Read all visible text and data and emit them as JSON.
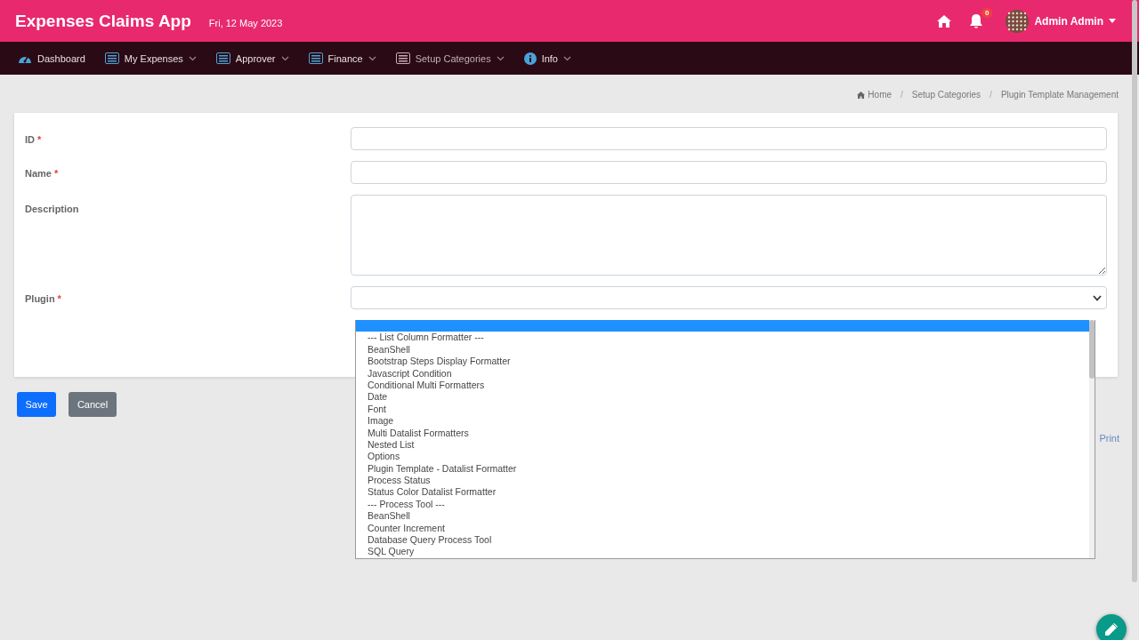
{
  "header": {
    "title": "Expenses Claims App",
    "date": "Fri, 12 May 2023",
    "notification_count": "0",
    "user": "Admin Admin"
  },
  "nav": [
    {
      "label": "Dashboard",
      "dropdown": false
    },
    {
      "label": "My Expenses",
      "dropdown": true
    },
    {
      "label": "Approver",
      "dropdown": true
    },
    {
      "label": "Finance",
      "dropdown": true
    },
    {
      "label": "Setup Categories",
      "dropdown": true
    },
    {
      "label": "Info",
      "dropdown": true
    }
  ],
  "breadcrumb": [
    {
      "label": "Home"
    },
    {
      "separator": "/",
      "label": "Setup Categories"
    },
    {
      "separator": "/",
      "label": "Plugin Template Management"
    }
  ],
  "form": {
    "fields": [
      {
        "label": "ID",
        "required_mark": "*",
        "kind": "text"
      },
      {
        "label": "Name",
        "required_mark": "*",
        "kind": "text"
      },
      {
        "label": "Description",
        "kind": "textarea"
      },
      {
        "label": "Plugin",
        "required_mark": "*",
        "kind": "select"
      }
    ]
  },
  "plugin_dropdown": {
    "options": [
      {
        "selected": true
      },
      {
        "label": "--- List Column Formatter ---",
        "selected": false
      },
      {
        "label": "BeanShell",
        "selected": false
      },
      {
        "label": "Bootstrap Steps Display Formatter",
        "selected": false
      },
      {
        "label": "Javascript Condition",
        "selected": false
      },
      {
        "label": "Conditional Multi Formatters",
        "selected": false
      },
      {
        "label": "Date",
        "selected": false
      },
      {
        "label": "Font",
        "selected": false
      },
      {
        "label": "Image",
        "selected": false
      },
      {
        "label": "Multi Datalist Formatters",
        "selected": false
      },
      {
        "label": "Nested List",
        "selected": false
      },
      {
        "label": "Options",
        "selected": false
      },
      {
        "label": "Plugin Template - Datalist Formatter",
        "selected": false
      },
      {
        "label": "Process Status",
        "selected": false
      },
      {
        "label": "Status Color Datalist Formatter",
        "selected": false
      },
      {
        "label": "--- Process Tool ---",
        "selected": false
      },
      {
        "label": "BeanShell",
        "selected": false
      },
      {
        "label": "Counter Increment",
        "selected": false
      },
      {
        "label": "Database Query Process Tool",
        "selected": false
      },
      {
        "label": "SQL Query",
        "selected": false
      }
    ]
  },
  "buttons": [
    {
      "label": "Save",
      "kind": "primary"
    },
    {
      "label": "Cancel",
      "kind": "secondary"
    }
  ],
  "print_link": "Print"
}
